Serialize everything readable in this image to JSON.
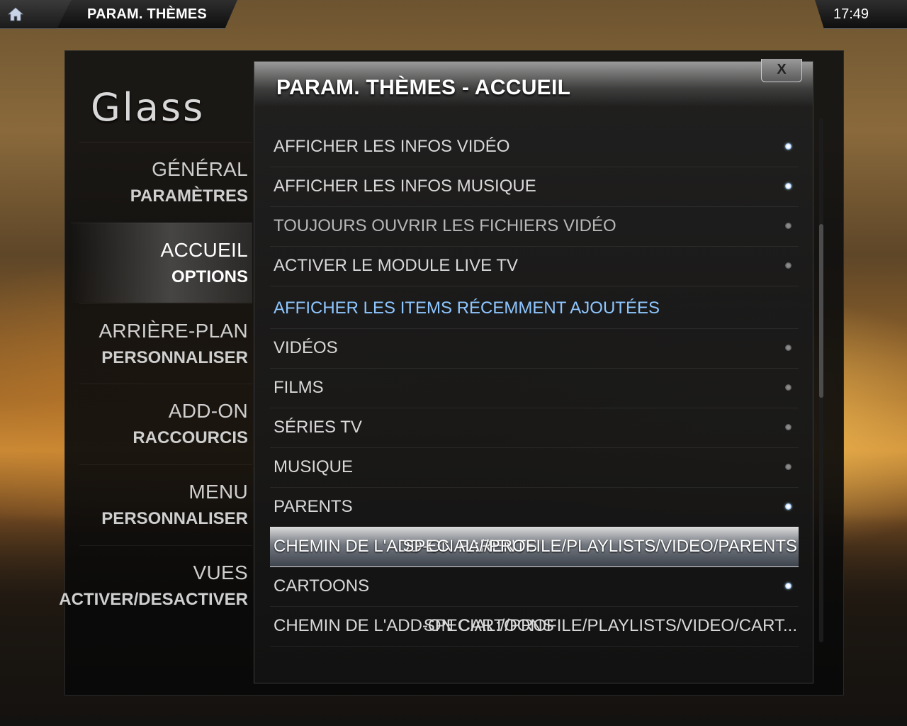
{
  "topbar": {
    "title": "PARAM. THÈMES",
    "clock": "17:49"
  },
  "skin": {
    "logo": "Glass"
  },
  "sidebar": {
    "items": [
      {
        "line1": "GÉNÉRAL",
        "line2": "PARAMÈTRES"
      },
      {
        "line1": "ACCUEIL",
        "line2": "OPTIONS"
      },
      {
        "line1": "ARRIÈRE-PLAN",
        "line2": "PERSONNALISER"
      },
      {
        "line1": "ADD-ON",
        "line2": "RACCOURCIS"
      },
      {
        "line1": "MENU",
        "line2": "PERSONNALISER"
      },
      {
        "line1": "VUES",
        "line2": "ACTIVER/DESACTIVER"
      }
    ]
  },
  "panel": {
    "title": "PARAM. THÈMES - ACCUEIL",
    "close_label": "X",
    "rows": [
      {
        "label": "AFFICHER LES INFOS VIDÉO",
        "state": "on"
      },
      {
        "label": "AFFICHER LES INFOS MUSIQUE",
        "state": "on"
      },
      {
        "label": "TOUJOURS OUVRIR LES FICHIERS VIDÉO",
        "state": "off"
      },
      {
        "label": "ACTIVER LE MODULE LIVE TV",
        "state": "off"
      },
      {
        "label": "AFFICHER LES ITEMS RÉCEMMENT AJOUTÉES"
      },
      {
        "label": "VIDÉOS",
        "state": "off"
      },
      {
        "label": "FILMS",
        "state": "off"
      },
      {
        "label": "SÉRIES TV",
        "state": "off"
      },
      {
        "label": "MUSIQUE",
        "state": "off"
      },
      {
        "label": "PARENTS",
        "state": "on"
      },
      {
        "label": "CHEMIN DE L'ADD-ON PARENTS",
        "value": "SPECIAL://PROFILE/PLAYLISTS/VIDEO/PARENTS"
      },
      {
        "label": "CARTOONS",
        "state": "on"
      },
      {
        "label": "CHEMIN DE L'ADD-ON CARTOONS",
        "value": "SPECIAL://PROFILE/PLAYLISTS/VIDEO/CART..."
      }
    ]
  },
  "colors": {
    "section": "#8ec6ff",
    "toggle_on": "#8fb7ff"
  }
}
